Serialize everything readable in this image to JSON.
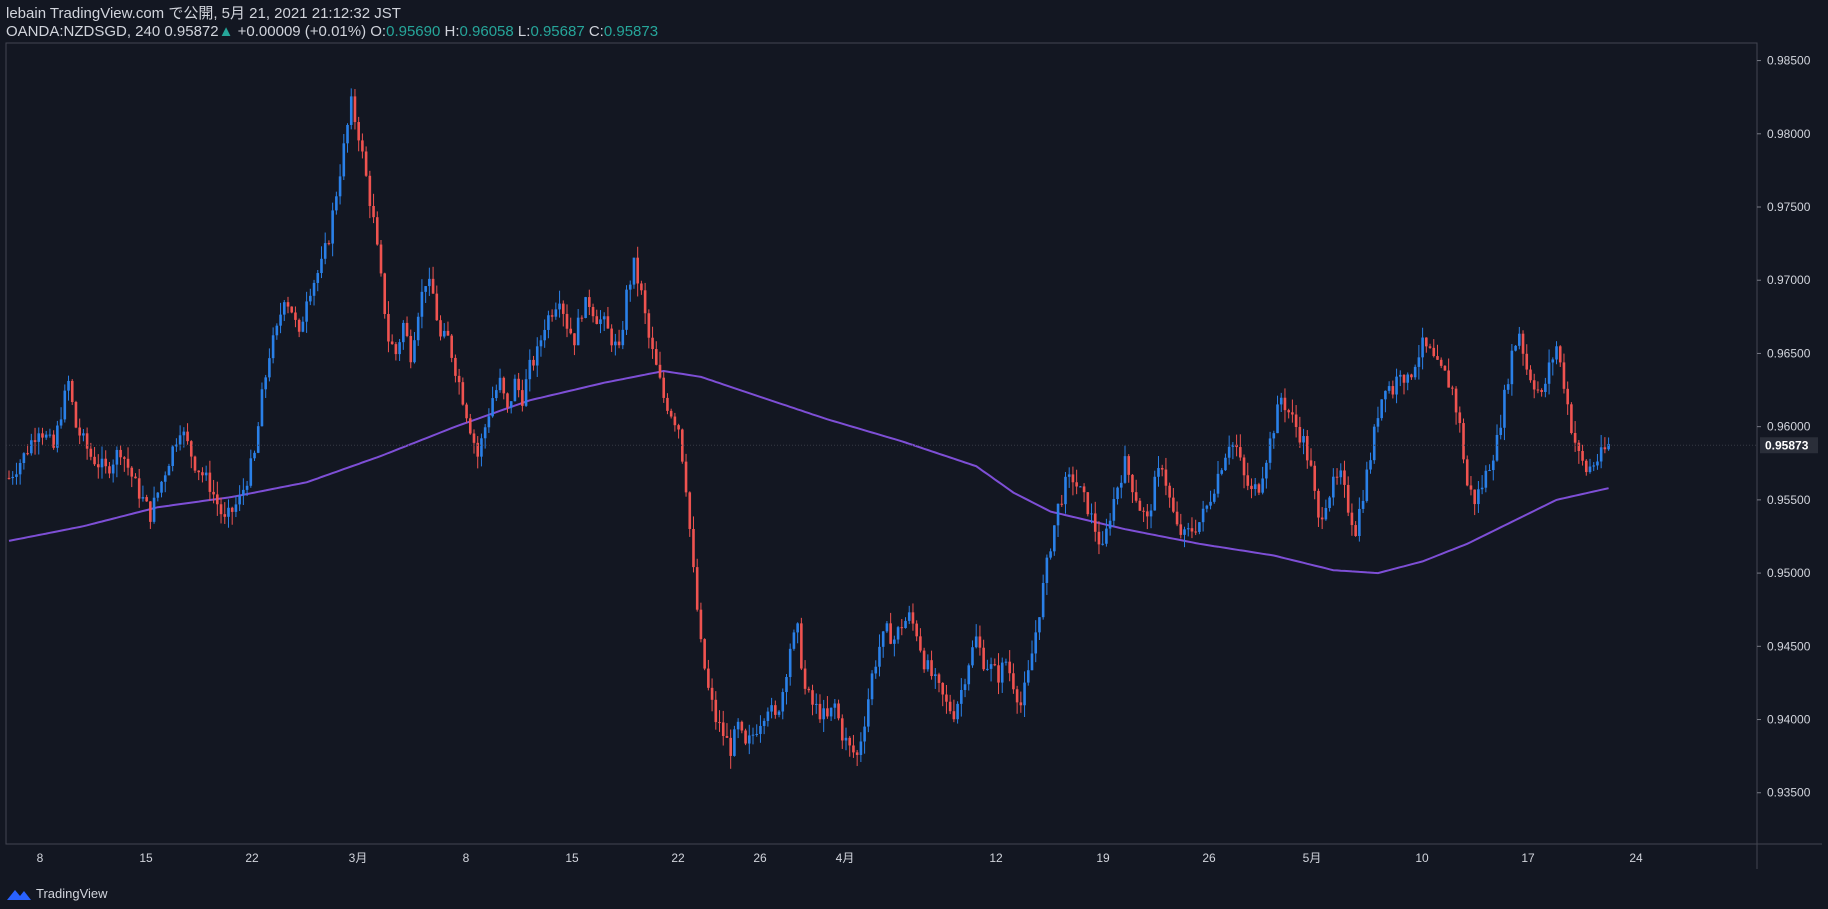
{
  "header": {
    "line1": "lebain TradingView.com で公開, 5月 21, 2021 21:12:32 JST",
    "symbol": "OANDA:NZDSGD, 240",
    "last": "0.95872",
    "change": "+0.00009 (+0.01%)",
    "o_label": "O:",
    "o_value": "0.95690",
    "h_label": "H:",
    "h_value": "0.96058",
    "l_label": "L:",
    "l_value": "0.95687",
    "c_label": "C:",
    "c_value": "0.95873"
  },
  "footer": {
    "brand": "TradingView",
    "logo_icon": "tradingview-logo-icon"
  },
  "colors": {
    "background": "#131722",
    "up": "#2a80e8",
    "down": "#ef5350",
    "ma": "#7e4fd6",
    "axis_text": "#d1d4dc",
    "price_label_bg": "#2a2e39"
  },
  "chart_data": {
    "type": "candlestick",
    "y_ticks": [
      "0.98500",
      "0.98000",
      "0.97500",
      "0.97000",
      "0.96500",
      "0.96000",
      "0.95500",
      "0.95000",
      "0.94500",
      "0.94000",
      "0.93500"
    ],
    "ylim": [
      0.9315,
      0.9862
    ],
    "x_ticks": [
      "8",
      "15",
      "22",
      "3月",
      "8",
      "15",
      "22",
      "26",
      "4月",
      "12",
      "19",
      "26",
      "5月",
      "10",
      "17",
      "24"
    ],
    "last_price_label": "0.95873",
    "close_path": [
      [
        0,
        0.9565
      ],
      [
        4,
        0.958
      ],
      [
        8,
        0.96
      ],
      [
        12,
        0.9585
      ],
      [
        14,
        0.961
      ],
      [
        16,
        0.963
      ],
      [
        18,
        0.96
      ],
      [
        22,
        0.958
      ],
      [
        26,
        0.957
      ],
      [
        30,
        0.9585
      ],
      [
        34,
        0.956
      ],
      [
        38,
        0.954
      ],
      [
        42,
        0.957
      ],
      [
        46,
        0.96
      ],
      [
        50,
        0.9575
      ],
      [
        54,
        0.956
      ],
      [
        58,
        0.9535
      ],
      [
        62,
        0.955
      ],
      [
        66,
        0.958
      ],
      [
        68,
        0.962
      ],
      [
        70,
        0.965
      ],
      [
        72,
        0.9665
      ],
      [
        74,
        0.969
      ],
      [
        76,
        0.968
      ],
      [
        78,
        0.966
      ],
      [
        80,
        0.969
      ],
      [
        82,
        0.97
      ],
      [
        84,
        0.971
      ],
      [
        86,
        0.973
      ],
      [
        88,
        0.976
      ],
      [
        90,
        0.979
      ],
      [
        92,
        0.982
      ],
      [
        94,
        0.98
      ],
      [
        96,
        0.977
      ],
      [
        98,
        0.974
      ],
      [
        100,
        0.97
      ],
      [
        102,
        0.966
      ],
      [
        104,
        0.965
      ],
      [
        106,
        0.967
      ],
      [
        108,
        0.965
      ],
      [
        110,
        0.968
      ],
      [
        112,
        0.97
      ],
      [
        114,
        0.969
      ],
      [
        116,
        0.966
      ],
      [
        118,
        0.966
      ],
      [
        120,
        0.964
      ],
      [
        122,
        0.962
      ],
      [
        124,
        0.96
      ],
      [
        126,
        0.958
      ],
      [
        128,
        0.96
      ],
      [
        130,
        0.962
      ],
      [
        132,
        0.963
      ],
      [
        134,
        0.961
      ],
      [
        136,
        0.963
      ],
      [
        138,
        0.962
      ],
      [
        140,
        0.964
      ],
      [
        142,
        0.965
      ],
      [
        144,
        0.967
      ],
      [
        146,
        0.968
      ],
      [
        148,
        0.969
      ],
      [
        150,
        0.967
      ],
      [
        152,
        0.966
      ],
      [
        154,
        0.968
      ],
      [
        156,
        0.9685
      ],
      [
        158,
        0.9675
      ],
      [
        160,
        0.967
      ],
      [
        162,
        0.966
      ],
      [
        164,
        0.965
      ],
      [
        166,
        0.969
      ],
      [
        168,
        0.971
      ],
      [
        170,
        0.969
      ],
      [
        172,
        0.966
      ],
      [
        174,
        0.964
      ],
      [
        176,
        0.962
      ],
      [
        178,
        0.961
      ],
      [
        180,
        0.96
      ],
      [
        182,
        0.956
      ],
      [
        184,
        0.95
      ],
      [
        186,
        0.945
      ],
      [
        188,
        0.942
      ],
      [
        190,
        0.94
      ],
      [
        192,
        0.939
      ],
      [
        194,
        0.938
      ],
      [
        196,
        0.9395
      ],
      [
        198,
        0.938
      ],
      [
        200,
        0.939
      ],
      [
        202,
        0.94
      ],
      [
        204,
        0.941
      ],
      [
        206,
        0.94
      ],
      [
        208,
        0.942
      ],
      [
        210,
        0.945
      ],
      [
        212,
        0.946
      ],
      [
        214,
        0.942
      ],
      [
        216,
        0.941
      ],
      [
        218,
        0.9405
      ],
      [
        220,
        0.94
      ],
      [
        222,
        0.941
      ],
      [
        224,
        0.939
      ],
      [
        226,
        0.938
      ],
      [
        228,
        0.9375
      ],
      [
        230,
        0.94
      ],
      [
        232,
        0.943
      ],
      [
        234,
        0.945
      ],
      [
        236,
        0.946
      ],
      [
        238,
        0.9455
      ],
      [
        240,
        0.9465
      ],
      [
        242,
        0.947
      ],
      [
        244,
        0.946
      ],
      [
        246,
        0.944
      ],
      [
        248,
        0.943
      ],
      [
        250,
        0.942
      ],
      [
        252,
        0.941
      ],
      [
        254,
        0.9405
      ],
      [
        256,
        0.942
      ],
      [
        258,
        0.944
      ],
      [
        260,
        0.9455
      ],
      [
        262,
        0.944
      ],
      [
        264,
        0.9435
      ],
      [
        266,
        0.943
      ],
      [
        268,
        0.944
      ],
      [
        270,
        0.9425
      ],
      [
        272,
        0.941
      ],
      [
        274,
        0.943
      ],
      [
        276,
        0.946
      ],
      [
        278,
        0.949
      ],
      [
        280,
        0.952
      ],
      [
        282,
        0.9545
      ],
      [
        284,
        0.956
      ],
      [
        286,
        0.9565
      ],
      [
        288,
        0.9555
      ],
      [
        290,
        0.9545
      ],
      [
        292,
        0.953
      ],
      [
        294,
        0.9515
      ],
      [
        296,
        0.954
      ],
      [
        298,
        0.956
      ],
      [
        300,
        0.9575
      ],
      [
        302,
        0.956
      ],
      [
        304,
        0.9545
      ],
      [
        306,
        0.9535
      ],
      [
        308,
        0.956
      ],
      [
        310,
        0.9575
      ],
      [
        312,
        0.955
      ],
      [
        314,
        0.953
      ],
      [
        316,
        0.9525
      ],
      [
        318,
        0.953
      ],
      [
        320,
        0.9535
      ],
      [
        322,
        0.9545
      ],
      [
        324,
        0.956
      ],
      [
        326,
        0.9575
      ],
      [
        328,
        0.959
      ],
      [
        330,
        0.9585
      ],
      [
        332,
        0.9565
      ],
      [
        334,
        0.9555
      ],
      [
        336,
        0.956
      ],
      [
        338,
        0.958
      ],
      [
        340,
        0.96
      ],
      [
        342,
        0.962
      ],
      [
        344,
        0.961
      ],
      [
        346,
        0.96
      ],
      [
        348,
        0.959
      ],
      [
        350,
        0.957
      ],
      [
        352,
        0.9535
      ],
      [
        354,
        0.955
      ],
      [
        356,
        0.956
      ],
      [
        358,
        0.9565
      ],
      [
        360,
        0.9545
      ],
      [
        362,
        0.953
      ],
      [
        364,
        0.9555
      ],
      [
        366,
        0.958
      ],
      [
        368,
        0.961
      ],
      [
        370,
        0.963
      ],
      [
        372,
        0.9625
      ],
      [
        374,
        0.964
      ],
      [
        376,
        0.963
      ],
      [
        378,
        0.9645
      ],
      [
        380,
        0.9655
      ],
      [
        382,
        0.965
      ],
      [
        384,
        0.964
      ],
      [
        386,
        0.9635
      ],
      [
        388,
        0.9625
      ],
      [
        390,
        0.96
      ],
      [
        392,
        0.956
      ],
      [
        394,
        0.955
      ],
      [
        396,
        0.956
      ],
      [
        398,
        0.9575
      ],
      [
        400,
        0.959
      ],
      [
        402,
        0.962
      ],
      [
        404,
        0.965
      ],
      [
        406,
        0.9665
      ],
      [
        408,
        0.964
      ],
      [
        410,
        0.963
      ],
      [
        412,
        0.962
      ],
      [
        414,
        0.964
      ],
      [
        416,
        0.9655
      ],
      [
        418,
        0.963
      ],
      [
        420,
        0.96
      ],
      [
        422,
        0.958
      ],
      [
        424,
        0.957
      ],
      [
        426,
        0.9575
      ],
      [
        428,
        0.958
      ],
      [
        430,
        0.9587
      ]
    ],
    "ma_path": [
      [
        0,
        0.9522
      ],
      [
        20,
        0.9532
      ],
      [
        40,
        0.9545
      ],
      [
        60,
        0.9552
      ],
      [
        80,
        0.9562
      ],
      [
        100,
        0.958
      ],
      [
        120,
        0.96
      ],
      [
        140,
        0.9618
      ],
      [
        160,
        0.963
      ],
      [
        176,
        0.9638
      ],
      [
        186,
        0.9634
      ],
      [
        200,
        0.9622
      ],
      [
        220,
        0.9605
      ],
      [
        240,
        0.959
      ],
      [
        260,
        0.9573
      ],
      [
        270,
        0.9555
      ],
      [
        280,
        0.9542
      ],
      [
        300,
        0.953
      ],
      [
        320,
        0.952
      ],
      [
        340,
        0.9512
      ],
      [
        356,
        0.9502
      ],
      [
        368,
        0.95
      ],
      [
        380,
        0.9508
      ],
      [
        392,
        0.952
      ],
      [
        404,
        0.9535
      ],
      [
        416,
        0.955
      ],
      [
        430,
        0.9558
      ]
    ]
  }
}
